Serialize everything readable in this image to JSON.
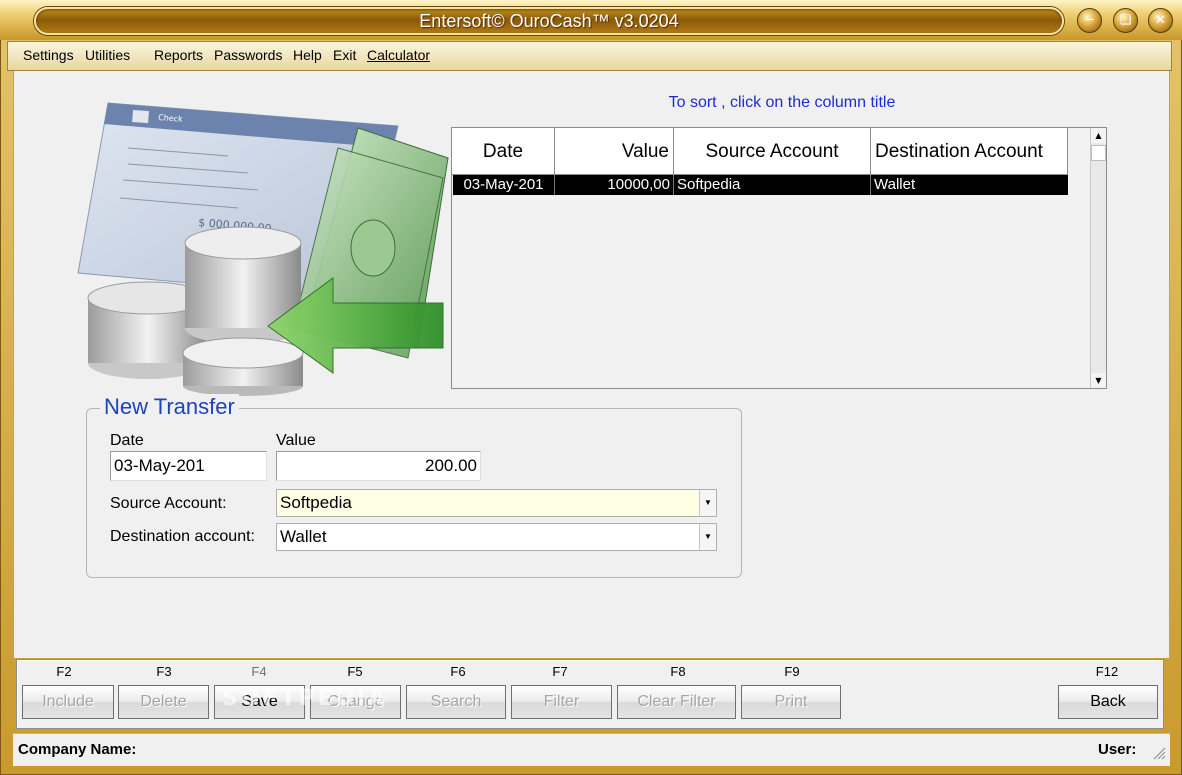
{
  "window": {
    "title": "Entersoft© OuroCash™ v3.0204",
    "controls": [
      "minimize-icon",
      "restore-icon",
      "close-icon"
    ]
  },
  "menu": {
    "items": [
      "Settings",
      "Utilities",
      "Reports",
      "Passwords",
      "Help",
      "Exit",
      "Calculator"
    ]
  },
  "hint": "To sort , click on the column title",
  "grid": {
    "columns": [
      "Date",
      "Value",
      "Source Account",
      "Destination Account"
    ],
    "rows": [
      {
        "date": "03-May-201",
        "value": "10000,00",
        "source": "Softpedia",
        "destination": "Wallet"
      }
    ]
  },
  "new_transfer": {
    "title": "New Transfer",
    "date_label": "Date",
    "date_value": "03-May-201",
    "value_label": "Value",
    "value_value": "200.00",
    "source_label": "Source Account:",
    "source_value": "Softpedia",
    "destination_label": "Destination account:",
    "destination_value": "Wallet"
  },
  "toolbar": {
    "keys": {
      "include": "F2",
      "delete": "F3",
      "save": "F4",
      "change": "F5",
      "search": "F6",
      "filter": "F7",
      "clear_filter": "F8",
      "print": "F9",
      "back": "F12"
    },
    "labels": {
      "include": "Include",
      "delete": "Delete",
      "save": "Save",
      "change": "Change",
      "search": "Search",
      "filter": "Filter",
      "clear_filter": "Clear Filter",
      "print": "Print",
      "back": "Back"
    }
  },
  "status": {
    "company_label": "Company Name:",
    "user_label": "User:"
  },
  "watermark": "SOFTPEDIA",
  "colors": {
    "frame_gold": "#c99a2e",
    "hint_blue": "#1d2ad4",
    "group_title_blue": "#1d43c2",
    "selected_row": "#000000",
    "source_field_bg": "#ffffe6"
  }
}
